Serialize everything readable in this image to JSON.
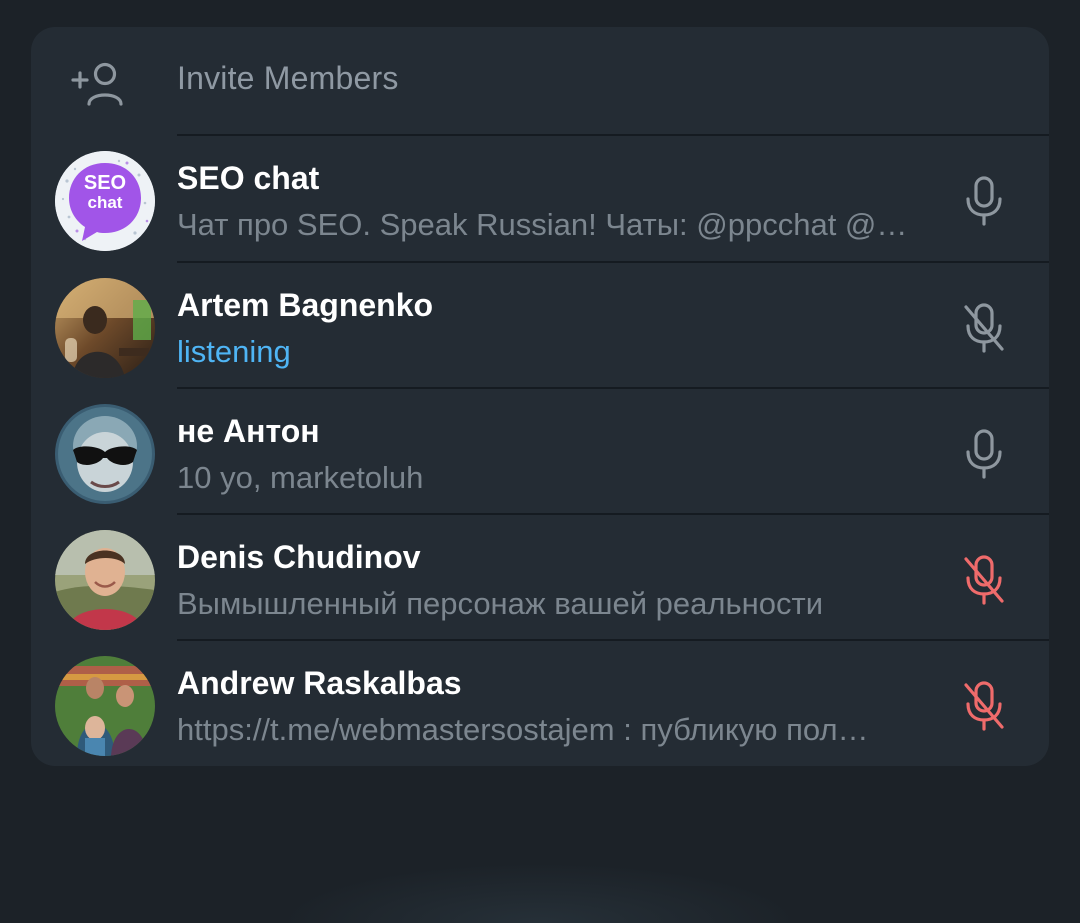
{
  "invite": {
    "label": "Invite Members",
    "icon": "add-user-icon"
  },
  "members": [
    {
      "name": "SEO chat",
      "status": "Чат про SEO. Speak Russian!  Чаты: @ppcchat @…",
      "status_state": "normal",
      "mic": "mic-on",
      "avatar_text": [
        "SEO",
        "chat"
      ]
    },
    {
      "name": "Artem Bagnenko",
      "status": "listening",
      "status_state": "active",
      "mic": "mic-muted"
    },
    {
      "name": "не Антон",
      "status": "10 yo, marketoluh",
      "status_state": "normal",
      "mic": "mic-on"
    },
    {
      "name": "Denis Chudinov",
      "status": "Вымышленный персонаж вашей реальности",
      "status_state": "normal",
      "mic": "mic-muted-by-admin"
    },
    {
      "name": "Andrew Raskalbas",
      "status": "https://t.me/webmastersostajem : публикую пол…",
      "status_state": "normal",
      "mic": "mic-muted-by-admin"
    }
  ],
  "colors": {
    "background": "#1c2228",
    "panel": "#242c34",
    "divider": "#151b21",
    "name": "#ffffff",
    "status": "#7c868f",
    "listening": "#4fb5f5",
    "mic_gray": "#8e979f",
    "mic_red": "#ef6b6b"
  }
}
